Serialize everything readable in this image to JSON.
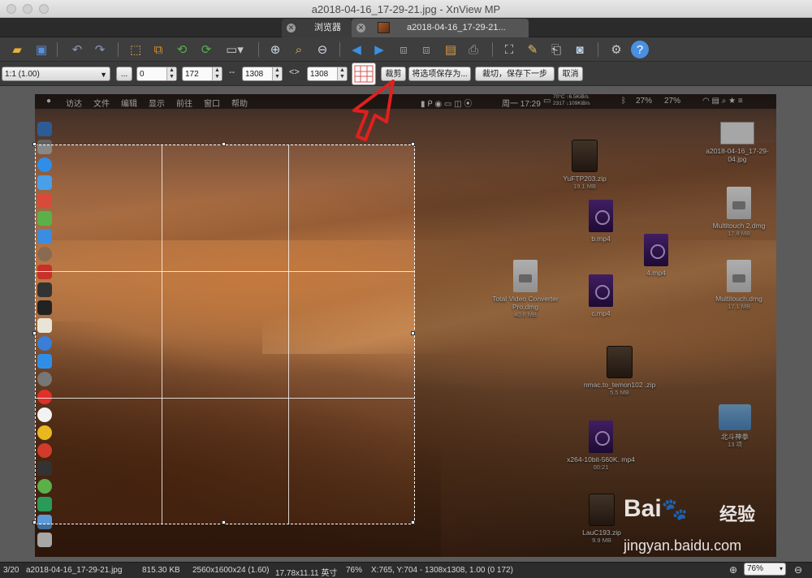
{
  "window": {
    "title": "a2018-04-16_17-29-21.jpg - XnView MP"
  },
  "tabs": [
    {
      "label": "浏览器"
    },
    {
      "label": "a2018-04-16_17-29-21..."
    }
  ],
  "toolbar": {
    "icons": [
      "open-folder-icon",
      "save-icon",
      "undo-icon",
      "redo-icon",
      "crop-tool-icon",
      "resize-icon",
      "rotate-left-icon",
      "rotate-right-icon",
      "adjust-icon",
      "zoom-in-icon",
      "zoom-fit-icon",
      "zoom-out-icon",
      "prev-icon",
      "next-icon",
      "first-icon",
      "last-icon",
      "slideshow-icon",
      "print-icon",
      "fullscreen-icon",
      "paint-icon",
      "scanner-icon",
      "camera-icon",
      "settings-icon",
      "help-icon"
    ]
  },
  "cropbar": {
    "ratio": "1:1 (1.00)",
    "more": "...",
    "x": "0",
    "y": "172",
    "sep1": "--",
    "width": "1308",
    "sep2": "<>",
    "height": "1308",
    "crop_btn": "裁剪",
    "save_opts_btn": "将选项保存为...",
    "crop_save_next_btn": "裁切，保存下一步",
    "cancel_btn": "取消"
  },
  "screenshot": {
    "menus": [
      "访达",
      "文件",
      "编辑",
      "显示",
      "前往",
      "窗口",
      "帮助"
    ],
    "clock": "周一 17:29",
    "net_up": "70°C ↑6.5KiB/s",
    "net_down": "2317 ↓109KiB/s",
    "battery1": "27%",
    "battery2": "27%",
    "desktop_icons": [
      {
        "name": "YuFTP203.zip",
        "size": "19.1 MB"
      },
      {
        "name": "b.mp4",
        "size": ""
      },
      {
        "name": "4.mp4",
        "size": ""
      },
      {
        "name": "Total Video Converter Pro.dmg",
        "size": "40.6 MB"
      },
      {
        "name": "c.mp4",
        "size": ""
      },
      {
        "name": "nmac.to_temon102 .zip",
        "size": "5.5 MB"
      },
      {
        "name": "x264-10bit-560K. mp4",
        "size": "00:21"
      },
      {
        "name": "LauC193.zip",
        "size": "9.9 MB"
      },
      {
        "name": "a2018-04-16_17-29-04.jpg",
        "size": ""
      },
      {
        "name": "Multitouch 2.dmg",
        "size": "17.8 MB"
      },
      {
        "name": "Multitouch.dmg",
        "size": "17.1 MB"
      },
      {
        "name": "北斗神拳",
        "size": "13 项"
      }
    ]
  },
  "watermark": {
    "brand": "Bai",
    "chinese": "经验",
    "url": "jingyan.baidu.com"
  },
  "status": {
    "index": "3/20",
    "filename": "a2018-04-16_17-29-21.jpg",
    "filesize": "815.30 KB",
    "dimensions": "2560x1600x24 (1.60)",
    "print_size": "17.78x11.11 英寸",
    "zoom_pct": "76%",
    "coords": "X:765, Y:704 - 1308x1308, 1.00 (0 172)",
    "zoom_select": "76%"
  },
  "colors": {
    "arrow": "#e0201e",
    "accent": "#4a90d9"
  }
}
